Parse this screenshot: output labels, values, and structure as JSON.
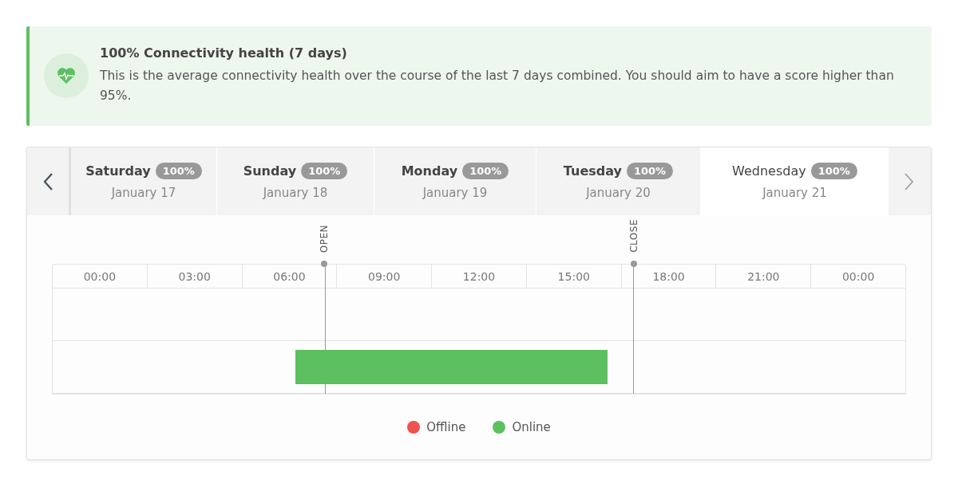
{
  "health_banner": {
    "title": "100% Connectivity health (7 days)",
    "description": "This is the average connectivity health over the course of the last 7 days combined. You should aim to have a score higher than 95%."
  },
  "day_tabs": [
    {
      "day": "Saturday",
      "score": "100%",
      "date": "January 17",
      "selected": false
    },
    {
      "day": "Sunday",
      "score": "100%",
      "date": "January 18",
      "selected": false
    },
    {
      "day": "Monday",
      "score": "100%",
      "date": "January 19",
      "selected": false
    },
    {
      "day": "Tuesday",
      "score": "100%",
      "date": "January 20",
      "selected": false
    },
    {
      "day": "Wednesday",
      "score": "100%",
      "date": "January 21",
      "selected": true
    }
  ],
  "timeline": {
    "hours": [
      "00:00",
      "03:00",
      "06:00",
      "09:00",
      "12:00",
      "15:00",
      "18:00",
      "21:00",
      "00:00"
    ],
    "markers": [
      {
        "label": "OPEN",
        "level": 0.319
      },
      {
        "label": "CLOSE",
        "level": 0.681
      }
    ],
    "segments": [
      {
        "kind": "online"
      }
    ]
  },
  "legend": [
    {
      "label": "Offline",
      "color": "#ef5350"
    },
    {
      "label": "Online",
      "color": "#5cbf60"
    }
  ]
}
